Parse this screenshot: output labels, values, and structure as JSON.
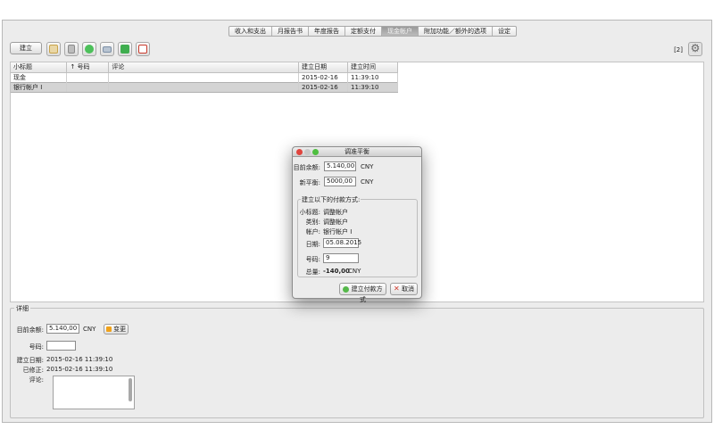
{
  "tabs": [
    {
      "label": "收入和支出",
      "active": false
    },
    {
      "label": "月报告书",
      "active": false
    },
    {
      "label": "年度报告",
      "active": false
    },
    {
      "label": "定额支付",
      "active": false
    },
    {
      "label": "现金帐户",
      "active": true
    },
    {
      "label": "附加功能／额外的选项",
      "active": false
    },
    {
      "label": "设定",
      "active": false
    }
  ],
  "toolbar": {
    "create_label": "建立",
    "page_count": "[2]",
    "icons": [
      "calendar-icon",
      "trash-icon",
      "refresh-icon",
      "print-icon",
      "export-excel-icon",
      "export-pdf-icon"
    ],
    "icon_colors": [
      "#c8a34a",
      "#9a9a9a",
      "#2e9e3a",
      "#7c8fa6",
      "#2f8d3d",
      "#c83a2c"
    ]
  },
  "table": {
    "columns": [
      "小标题",
      "↑ 号码",
      "评论",
      "建立日期",
      "建立时间"
    ],
    "rows": [
      {
        "title": "现金",
        "number": "",
        "comment": "",
        "date": "2015-02-16",
        "time": "11:39:10",
        "selected": false
      },
      {
        "title": "银行帐户 I",
        "number": "",
        "comment": "",
        "date": "2015-02-16",
        "time": "11:39:10",
        "selected": true
      }
    ]
  },
  "details": {
    "legend": "详细",
    "balance_label": "目前余额:",
    "balance_value": "5.140,00",
    "currency": "CNY",
    "change_label": "变更",
    "number_label": "号码:",
    "number_value": "",
    "created_label": "建立日期:",
    "created_value": "2015-02-16 11:39:10",
    "modified_label": "已修正:",
    "modified_value": "2015-02-16 11:39:10",
    "comment_label": "评论:"
  },
  "dialog": {
    "title": "调准平衡",
    "current_label": "目前余额:",
    "current_value": "5.140,00",
    "new_label": "新平衡:",
    "new_value": "5000,00",
    "currency": "CNY",
    "group_legend": "建立以下的付款方式:",
    "subtitle_label": "小标题:",
    "subtitle_value": "调整帐户",
    "category_label": "类别:",
    "category_value": "调整帐户",
    "account_label": "帐户:",
    "account_value": "银行帐户 I",
    "date_label": "日期:",
    "date_value": "05.08.2015",
    "number_label": "号码:",
    "number_value": "9",
    "total_label": "总量:",
    "total_value": "-140,00",
    "total_currency": "CNY",
    "create_payment_label": "建立付款方式",
    "cancel_label": "取消",
    "colors": {
      "close": "#e0443e",
      "minimize": "#c9c9c9",
      "zoom": "#4fbf40"
    }
  }
}
